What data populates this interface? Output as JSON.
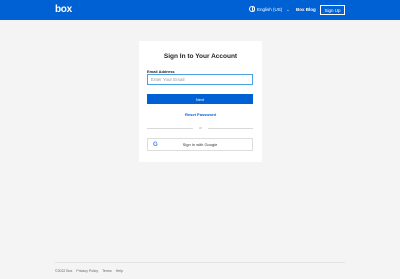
{
  "header": {
    "logo_text": "box",
    "language_label": "English (US)",
    "blog_label": "Box Blog",
    "signup_label": "Sign Up"
  },
  "signin": {
    "title": "Sign In to Your Account",
    "email_label": "Email Address",
    "email_placeholder": "Enter Your Email",
    "next_label": "Next",
    "reset_label": "Reset Password",
    "or_label": "or",
    "google_label": "Sign In with Google"
  },
  "footer": {
    "copyright": "©2022 Box",
    "privacy": "Privacy Policy",
    "terms": "Terms",
    "help": "Help"
  },
  "colors": {
    "brand_blue": "#0061d5",
    "page_bg": "#f4f4f4"
  }
}
